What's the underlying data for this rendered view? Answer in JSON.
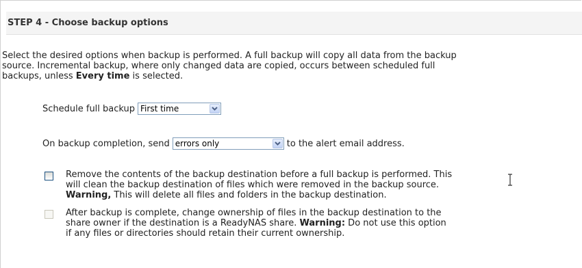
{
  "step": {
    "title": "STEP 4 - Choose backup options"
  },
  "intro": {
    "line1": "Select the desired options when backup is performed. A full backup will copy all data from the backup",
    "line2": "source. Incremental backup, where only changed data are copied, occurs between scheduled full",
    "line3_pre": "backups, unless ",
    "line3_bold": "Every time",
    "line3_post": " is selected."
  },
  "schedule": {
    "label": "Schedule full backup",
    "selected": "First time"
  },
  "send": {
    "label_pre": "On backup completion, send",
    "selected": "errors only",
    "label_post": "to the alert email address."
  },
  "option_remove": {
    "checked": false,
    "enabled": true,
    "line1": "Remove the contents of the backup destination before a full backup is performed. This",
    "line2": "will clean the backup destination of files which were removed in the backup source.",
    "line3_bold": "Warning,",
    "line3_post": " This will delete all files and folders in the backup destination."
  },
  "option_ownership": {
    "checked": false,
    "enabled": false,
    "line1": "After backup is complete, change ownership of files in the backup destination to the",
    "line2_pre": "share owner if the destination is a ReadyNAS share. ",
    "line2_bold": "Warning:",
    "line2_post": " Do not use this option",
    "line3": "if any files or directories should retain their current ownership."
  },
  "icons": {
    "dropdown": "chevron-down-icon",
    "cursor": "text-cursor-icon"
  },
  "colors": {
    "header_bg": "#f4f4f4",
    "select_border": "#7f9db9",
    "checkbox_border": "#1c5180"
  }
}
